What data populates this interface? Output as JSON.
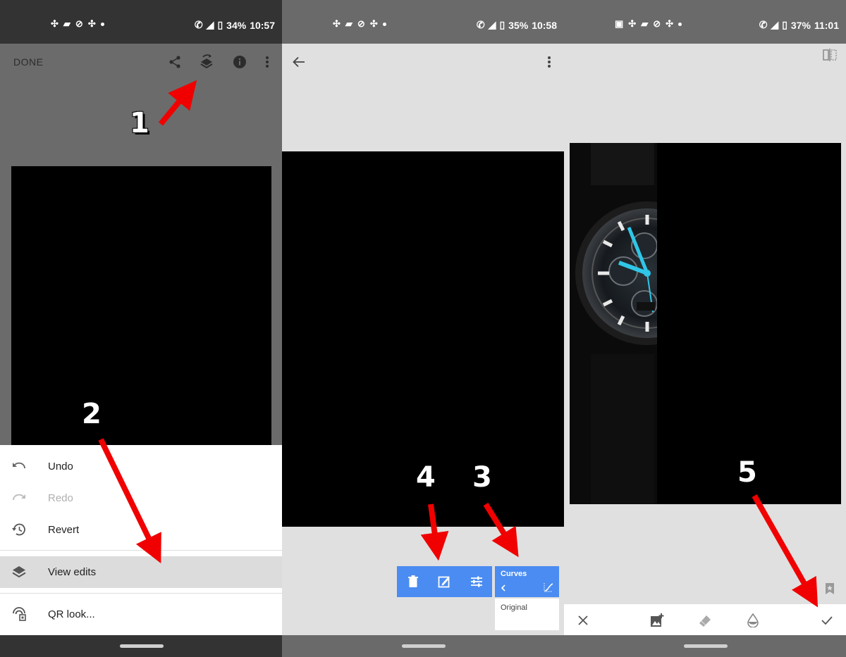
{
  "status_bars": [
    {
      "battery": "34%",
      "time": "10:57"
    },
    {
      "battery": "35%",
      "time": "10:58"
    },
    {
      "battery": "37%",
      "time": "11:01"
    }
  ],
  "panel1": {
    "done_label": "DONE",
    "menu": [
      {
        "label": "Undo",
        "icon": "undo-icon"
      },
      {
        "label": "Redo",
        "icon": "redo-icon"
      },
      {
        "label": "Revert",
        "icon": "history-icon"
      },
      {
        "label": "View edits",
        "icon": "layers-icon"
      },
      {
        "label": "QR look...",
        "icon": "qr-look-icon"
      }
    ]
  },
  "panel2": {
    "curves_label": "Curves",
    "original_label": "Original"
  },
  "annotations": [
    "1",
    "2",
    "3",
    "4",
    "5"
  ],
  "colors": {
    "accent_blue": "#4a8cf1",
    "arrow_red": "#f00000",
    "cyan_hands": "#2fc6e8"
  }
}
